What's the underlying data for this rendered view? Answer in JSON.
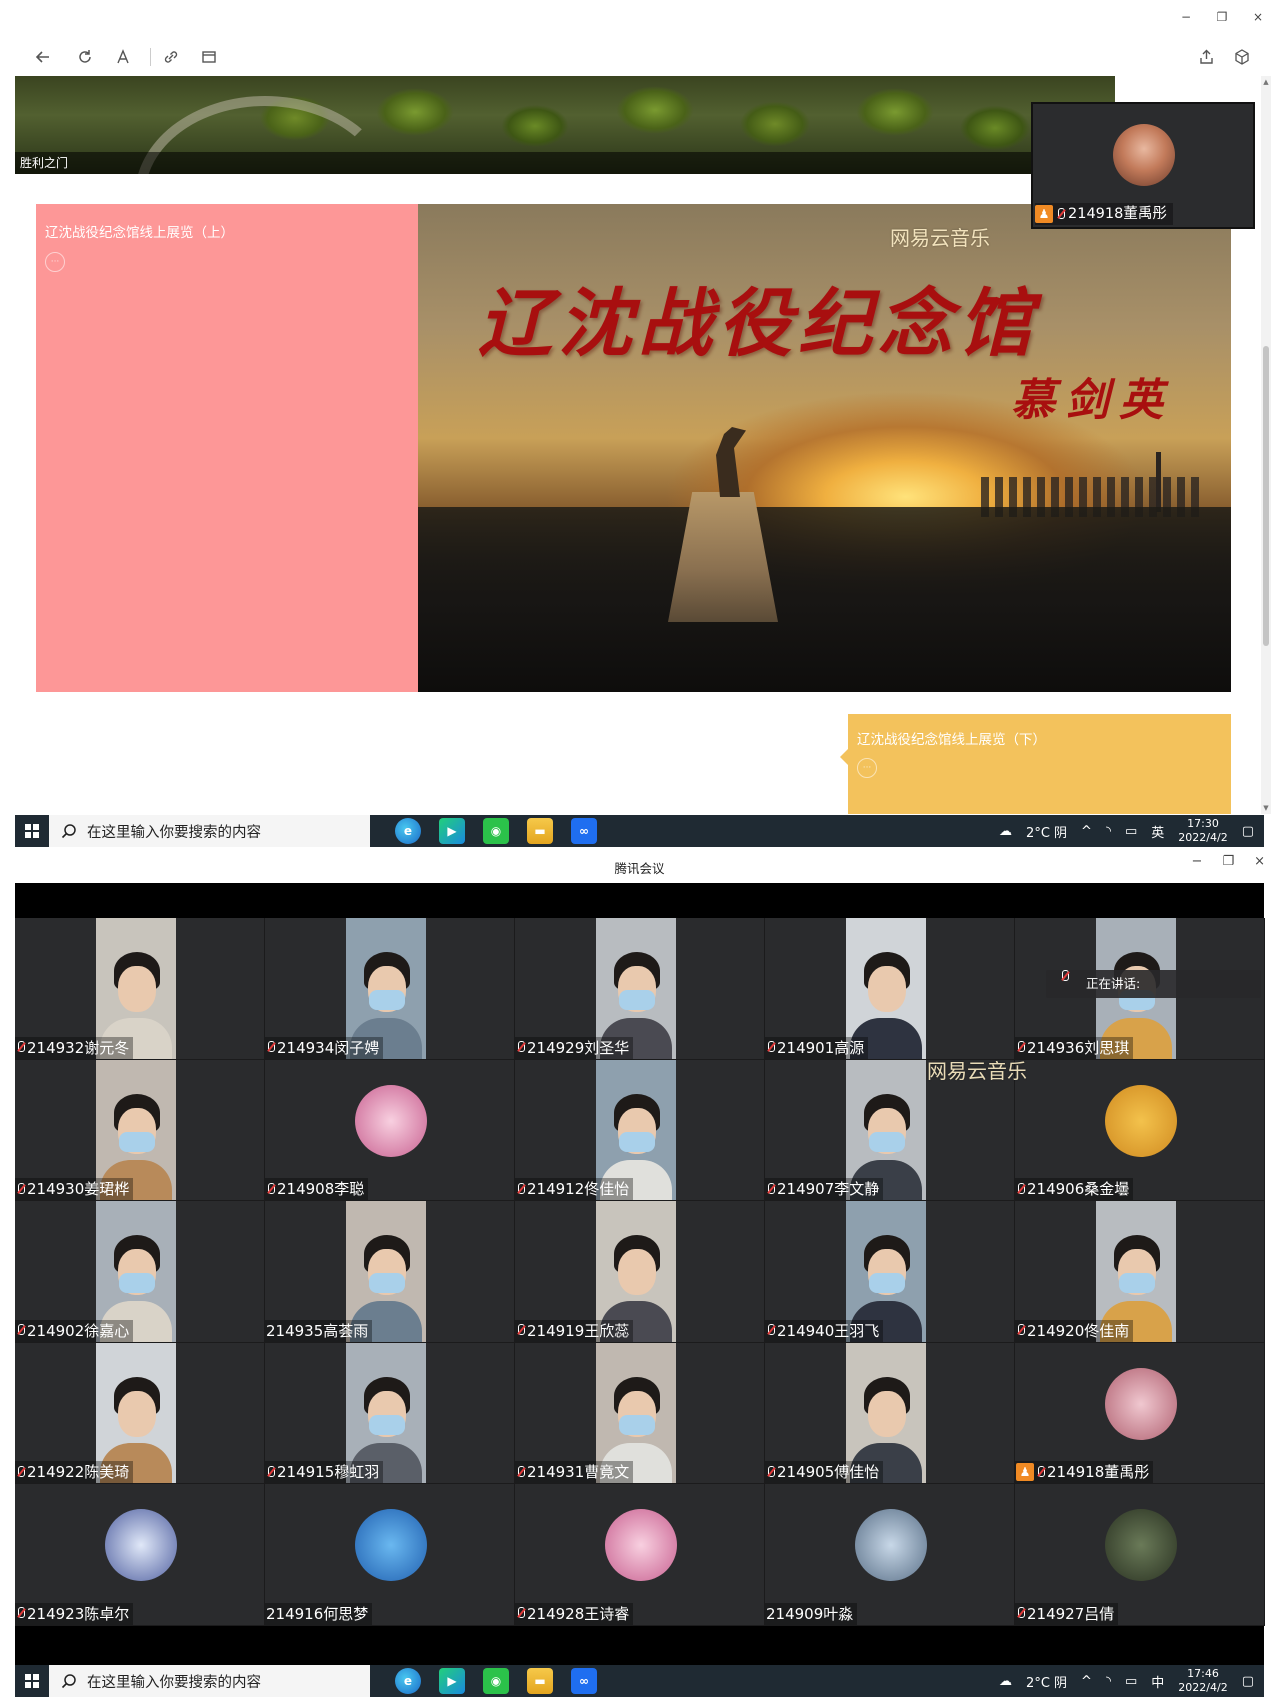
{
  "browser": {
    "window_controls": [
      "−",
      "❐",
      "×"
    ],
    "banner_caption": "胜利之门",
    "card_upper_title": "辽沈战役纪念馆线上展览（上）",
    "card_lower_title": "辽沈战役纪念馆线上展览（下）",
    "hero_title": "辽沈战役纪念馆",
    "hero_signature": "慕剑英",
    "watermark": "网易云音乐",
    "floating_participant": "214918董禹彤"
  },
  "taskbar_top": {
    "search_placeholder": "在这里输入你要搜索的内容",
    "weather": "2°C 阴",
    "ime": "英",
    "time": "17:30",
    "date": "2022/4/2"
  },
  "meeting": {
    "title": "腾讯会议",
    "window_controls": [
      "−",
      "❐",
      "×"
    ],
    "speaking_label": "正在讲话:",
    "watermark": "网易云音乐",
    "participants": [
      {
        "name": "214932谢元冬",
        "muted": true,
        "kind": "cam"
      },
      {
        "name": "214934闵子娉",
        "muted": true,
        "kind": "cam"
      },
      {
        "name": "214929刘圣华",
        "muted": true,
        "kind": "cam"
      },
      {
        "name": "214901高源",
        "muted": true,
        "kind": "cam"
      },
      {
        "name": "214936刘思琪",
        "muted": true,
        "kind": "cam"
      },
      {
        "name": "214930姜珺桦",
        "muted": true,
        "kind": "cam"
      },
      {
        "name": "214908李聪",
        "muted": true,
        "kind": "avatar"
      },
      {
        "name": "214912佟佳怡",
        "muted": true,
        "kind": "cam"
      },
      {
        "name": "214907李文静",
        "muted": true,
        "kind": "cam"
      },
      {
        "name": "214906桑金壜",
        "muted": true,
        "kind": "avatar"
      },
      {
        "name": "214902徐嘉心",
        "muted": true,
        "kind": "cam"
      },
      {
        "name": "214935高荟雨",
        "muted": false,
        "kind": "cam"
      },
      {
        "name": "214919王欣蕊",
        "muted": true,
        "kind": "cam"
      },
      {
        "name": "214940王羽飞",
        "muted": true,
        "kind": "cam"
      },
      {
        "name": "214920佟佳南",
        "muted": true,
        "kind": "cam"
      },
      {
        "name": "214922陈美琦",
        "muted": true,
        "kind": "cam"
      },
      {
        "name": "214915穆虹羽",
        "muted": true,
        "kind": "cam"
      },
      {
        "name": "214931曹竟文",
        "muted": true,
        "kind": "cam"
      },
      {
        "name": "214905傅佳怡",
        "muted": true,
        "kind": "cam"
      },
      {
        "name": "214918董禹彤",
        "muted": true,
        "kind": "avatar",
        "host": true
      },
      {
        "name": "214923陈卓尔",
        "muted": true,
        "kind": "avatar"
      },
      {
        "name": "214916何思梦",
        "muted": false,
        "kind": "avatar"
      },
      {
        "name": "214928王诗睿",
        "muted": true,
        "kind": "avatar"
      },
      {
        "name": "214909叶淼",
        "muted": false,
        "kind": "avatar"
      },
      {
        "name": "214927吕倩",
        "muted": true,
        "kind": "avatar"
      }
    ]
  },
  "taskbar_bottom": {
    "search_placeholder": "在这里输入你要搜索的内容",
    "weather": "2°C 阴",
    "ime": "中",
    "time": "17:46",
    "date": "2022/4/2"
  },
  "colors": {
    "pink_card": "#fd9797",
    "yellow_card": "#f3c25c",
    "hero_title_red": "#a80f0f",
    "taskbar": "#1f2a33",
    "tile_bg": "#2a2b2d",
    "host_badge": "#f08a24"
  }
}
